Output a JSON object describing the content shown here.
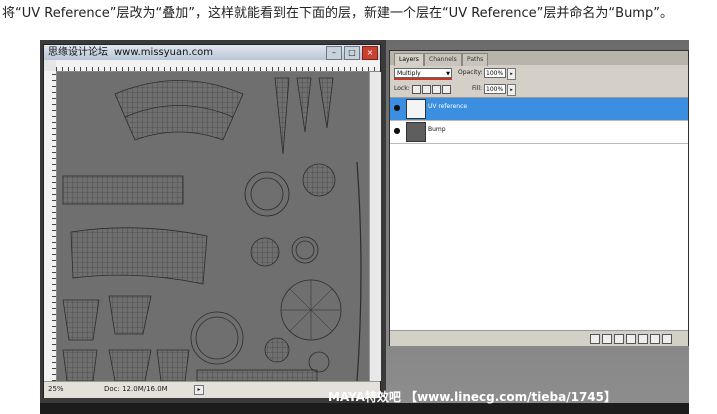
{
  "caption": "将“UV Reference”层改为“叠加”，这样就能看到在下面的层，新建一个层在“UV Reference”层并命名为“Bump”。",
  "document": {
    "title_prefix": "思缘设计论坛",
    "title_site": "www.missyuan.com",
    "zoom": "25%",
    "doc_size": "Doc: 12.0M/16.0M"
  },
  "layers_panel": {
    "tabs": [
      "Layers",
      "Channels",
      "Paths"
    ],
    "blend_mode": "Multiply",
    "opacity_label": "Opacity:",
    "opacity_value": "100%",
    "lock_label": "Lock:",
    "fill_label": "Fill:",
    "fill_value": "100%",
    "layers": [
      {
        "name": "UV reference",
        "selected": true
      },
      {
        "name": "Bump",
        "selected": false
      }
    ]
  },
  "watermark": "MAYA特效吧  【www.linecg.com/tieba/1745】",
  "colors": {
    "selection": "#3b8ee0",
    "canvas": "#6f6f6f"
  }
}
